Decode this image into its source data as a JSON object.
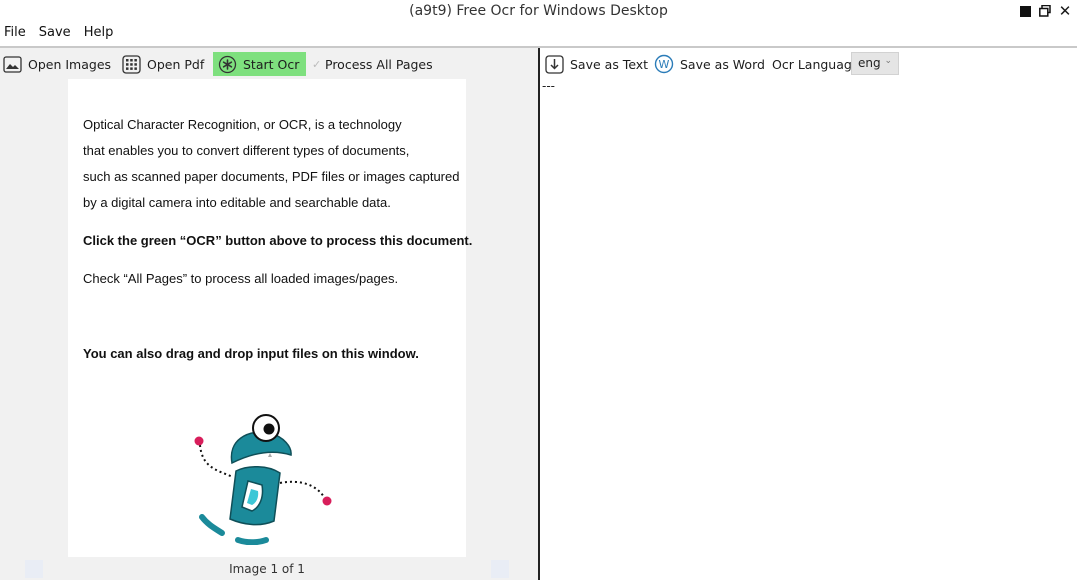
{
  "window": {
    "title": "(a9t9) Free Ocr for Windows Desktop"
  },
  "menu": {
    "items": [
      "File",
      "Save",
      "Help"
    ]
  },
  "left_toolbar": {
    "open_images": "Open Images",
    "open_pdf": "Open Pdf",
    "start_ocr": "Start Ocr",
    "process_all_pages": "Process All Pages",
    "start_ocr_color": "#7ee07e"
  },
  "document": {
    "lines": [
      "Optical Character Recognition, or OCR, is a technology",
      "that enables you to convert different types of documents,",
      "such as scanned paper documents, PDF files or images captured",
      "by a digital camera into editable and searchable data.",
      "Click the green “OCR” button above to process this document.",
      "Check “All Pages” to process all loaded images/pages.",
      "You can also drag and drop input files on this window."
    ],
    "image_counter": "Image 1 of 1",
    "mascot_color": "#1b8a9a"
  },
  "right_toolbar": {
    "save_as_text": "Save as Text",
    "save_as_word": "Save as Word",
    "ocr_language_label": "Ocr Language",
    "ocr_language_value": "eng"
  },
  "output": {
    "text": "---"
  }
}
